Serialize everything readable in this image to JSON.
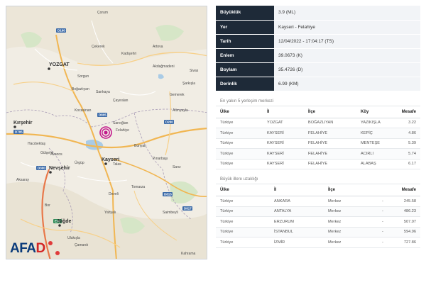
{
  "brand": {
    "logo_text_blue": "AFA",
    "logo_text_red": "D"
  },
  "colors": {
    "header_dark": "#1e2a38",
    "epicenter": "#c2188c",
    "afad_blue": "#0a3a7a",
    "afad_red": "#d42424"
  },
  "map": {
    "cities": {
      "yozgat": "YOZGAT",
      "kayseri": "Kayseri",
      "kirsehir": "Kırşehir",
      "nevsehir": "Nevşehir",
      "nigde": "Niğde",
      "kahraman": "Kahrama"
    },
    "places": [
      "Çorum",
      "Çekerek",
      "Kadışehri",
      "Artova",
      "Akdağmadeni",
      "Boğazlıyan",
      "Sarıkaya",
      "Sorgun",
      "Çayıralan",
      "Kocasinan",
      "Sarıoğlan",
      "Felahiye",
      "Bünyan",
      "Talas",
      "Hacıbektaş",
      "Avanos",
      "Ürgüp",
      "Develi",
      "Tomarza",
      "Pınarbaşı",
      "Sarız",
      "Saimbeyli",
      "Yahyalı",
      "Bor",
      "Ulukışla",
      "Çamardı",
      "Aksaray",
      "Gülşehir",
      "Şarkışla",
      "Altınyayla",
      "Gemerek",
      "Sivas"
    ],
    "road_codes": [
      "D190",
      "D795",
      "D805",
      "D260",
      "D300",
      "D815",
      "D817",
      "E90"
    ],
    "epicenter_icon": "epicenter-target-icon"
  },
  "quake": {
    "rows": [
      {
        "key": "Büyüklük",
        "value": "3.9 (ML)"
      },
      {
        "key": "Yer",
        "value": "Kayseri - Felahiye"
      },
      {
        "key": "Tarih",
        "value": "12/04/2022 - 17:04:17 (TS)"
      },
      {
        "key": "Enlem",
        "value": "39.0673 (K)"
      },
      {
        "key": "Boylam",
        "value": "35.4726 (D)"
      },
      {
        "key": "Derinlik",
        "value": "6.99 (KM)"
      }
    ]
  },
  "nearest": {
    "title": "En yakın 5 yerleşim merkezi",
    "headers": [
      "Ülke",
      "İl",
      "İlçe",
      "Köy",
      "Mesafe"
    ],
    "rows": [
      [
        "Türkiye",
        "YOZGAT",
        "BOĞAZLIYAN",
        "YAZIKIŞLA",
        "3.22"
      ],
      [
        "Türkiye",
        "KAYSERİ",
        "FELAHİYE",
        "KEPİÇ",
        "4.86"
      ],
      [
        "Türkiye",
        "KAYSERİ",
        "FELAHİYE",
        "MENTEŞE",
        "5.39"
      ],
      [
        "Türkiye",
        "KAYSERİ",
        "FELAHİYE",
        "ACIRLI",
        "5.74"
      ],
      [
        "Türkiye",
        "KAYSERİ",
        "FELAHİYE",
        "ALABAŞ",
        "6.17"
      ]
    ]
  },
  "cities": {
    "title": "Büyük illere uzaklığı",
    "headers": [
      "Ülke",
      "İl",
      "İlçe",
      "",
      "Mesafe"
    ],
    "rows": [
      [
        "Türkiye",
        "ANKARA",
        "Merkez",
        "-",
        "245.58"
      ],
      [
        "Türkiye",
        "ANTALYA",
        "Merkez",
        "-",
        "486.23"
      ],
      [
        "Türkiye",
        "ERZURUM",
        "Merkez",
        "-",
        "507.07"
      ],
      [
        "Türkiye",
        "İSTANBUL",
        "Merkez",
        "-",
        "594.96"
      ],
      [
        "Türkiye",
        "İZMİR",
        "Merkez",
        "-",
        "727.86"
      ]
    ]
  }
}
